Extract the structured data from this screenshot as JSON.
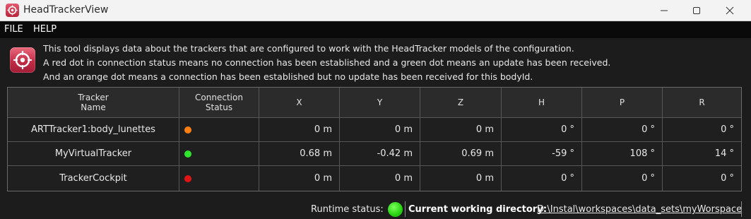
{
  "window": {
    "title": "HeadTrackerView",
    "icon": "target-icon"
  },
  "menu": {
    "file": "FILE",
    "help": "HELP"
  },
  "info": {
    "icon": "target-icon",
    "lines": [
      "This tool displays data about the trackers that are configured to work with the HeadTracker models of the configuration.",
      "A red dot in connection status means no connection has been established and a green dot means an update has been received.",
      "And an orange dot means a connection has been established but no update has been received for this bodyId."
    ]
  },
  "table": {
    "headers": {
      "name_line1": "Tracker",
      "name_line2": "Name",
      "status_line1": "Connection",
      "status_line2": "Status",
      "x": "X",
      "y": "Y",
      "z": "Z",
      "h": "H",
      "p": "P",
      "r": "R"
    },
    "rows": [
      {
        "name": "ARTTracker1:body_lunettes",
        "status": "orange",
        "status_color": "#ff7f0f",
        "x": "0 m",
        "y": "0 m",
        "z": "0 m",
        "h": "0 °",
        "p": "0 °",
        "r": "0 °"
      },
      {
        "name": "MyVirtualTracker",
        "status": "green",
        "status_color": "#2ee62e",
        "x": "0.68 m",
        "y": "-0.42 m",
        "z": "0.69 m",
        "h": "-59 °",
        "p": "108 °",
        "r": "14 °"
      },
      {
        "name": "TrackerCockpit",
        "status": "red",
        "status_color": "#e01414",
        "x": "0 m",
        "y": "0 m",
        "z": "0 m",
        "h": "0 °",
        "p": "0 °",
        "r": "0 °"
      }
    ]
  },
  "status_bar": {
    "runtime_label": "Runtime status:",
    "runtime_status": "green",
    "runtime_color": "#2bd614",
    "cwd_label": "Current working directory:",
    "cwd_value": "D:\\Instal\\workspaces\\data_sets\\myWorspace"
  },
  "colors": {
    "background": "#1c1c1c",
    "menubar": "#0a0a0a",
    "titlebar": "#f3f3f3",
    "icon_accent": "#c22c46"
  }
}
